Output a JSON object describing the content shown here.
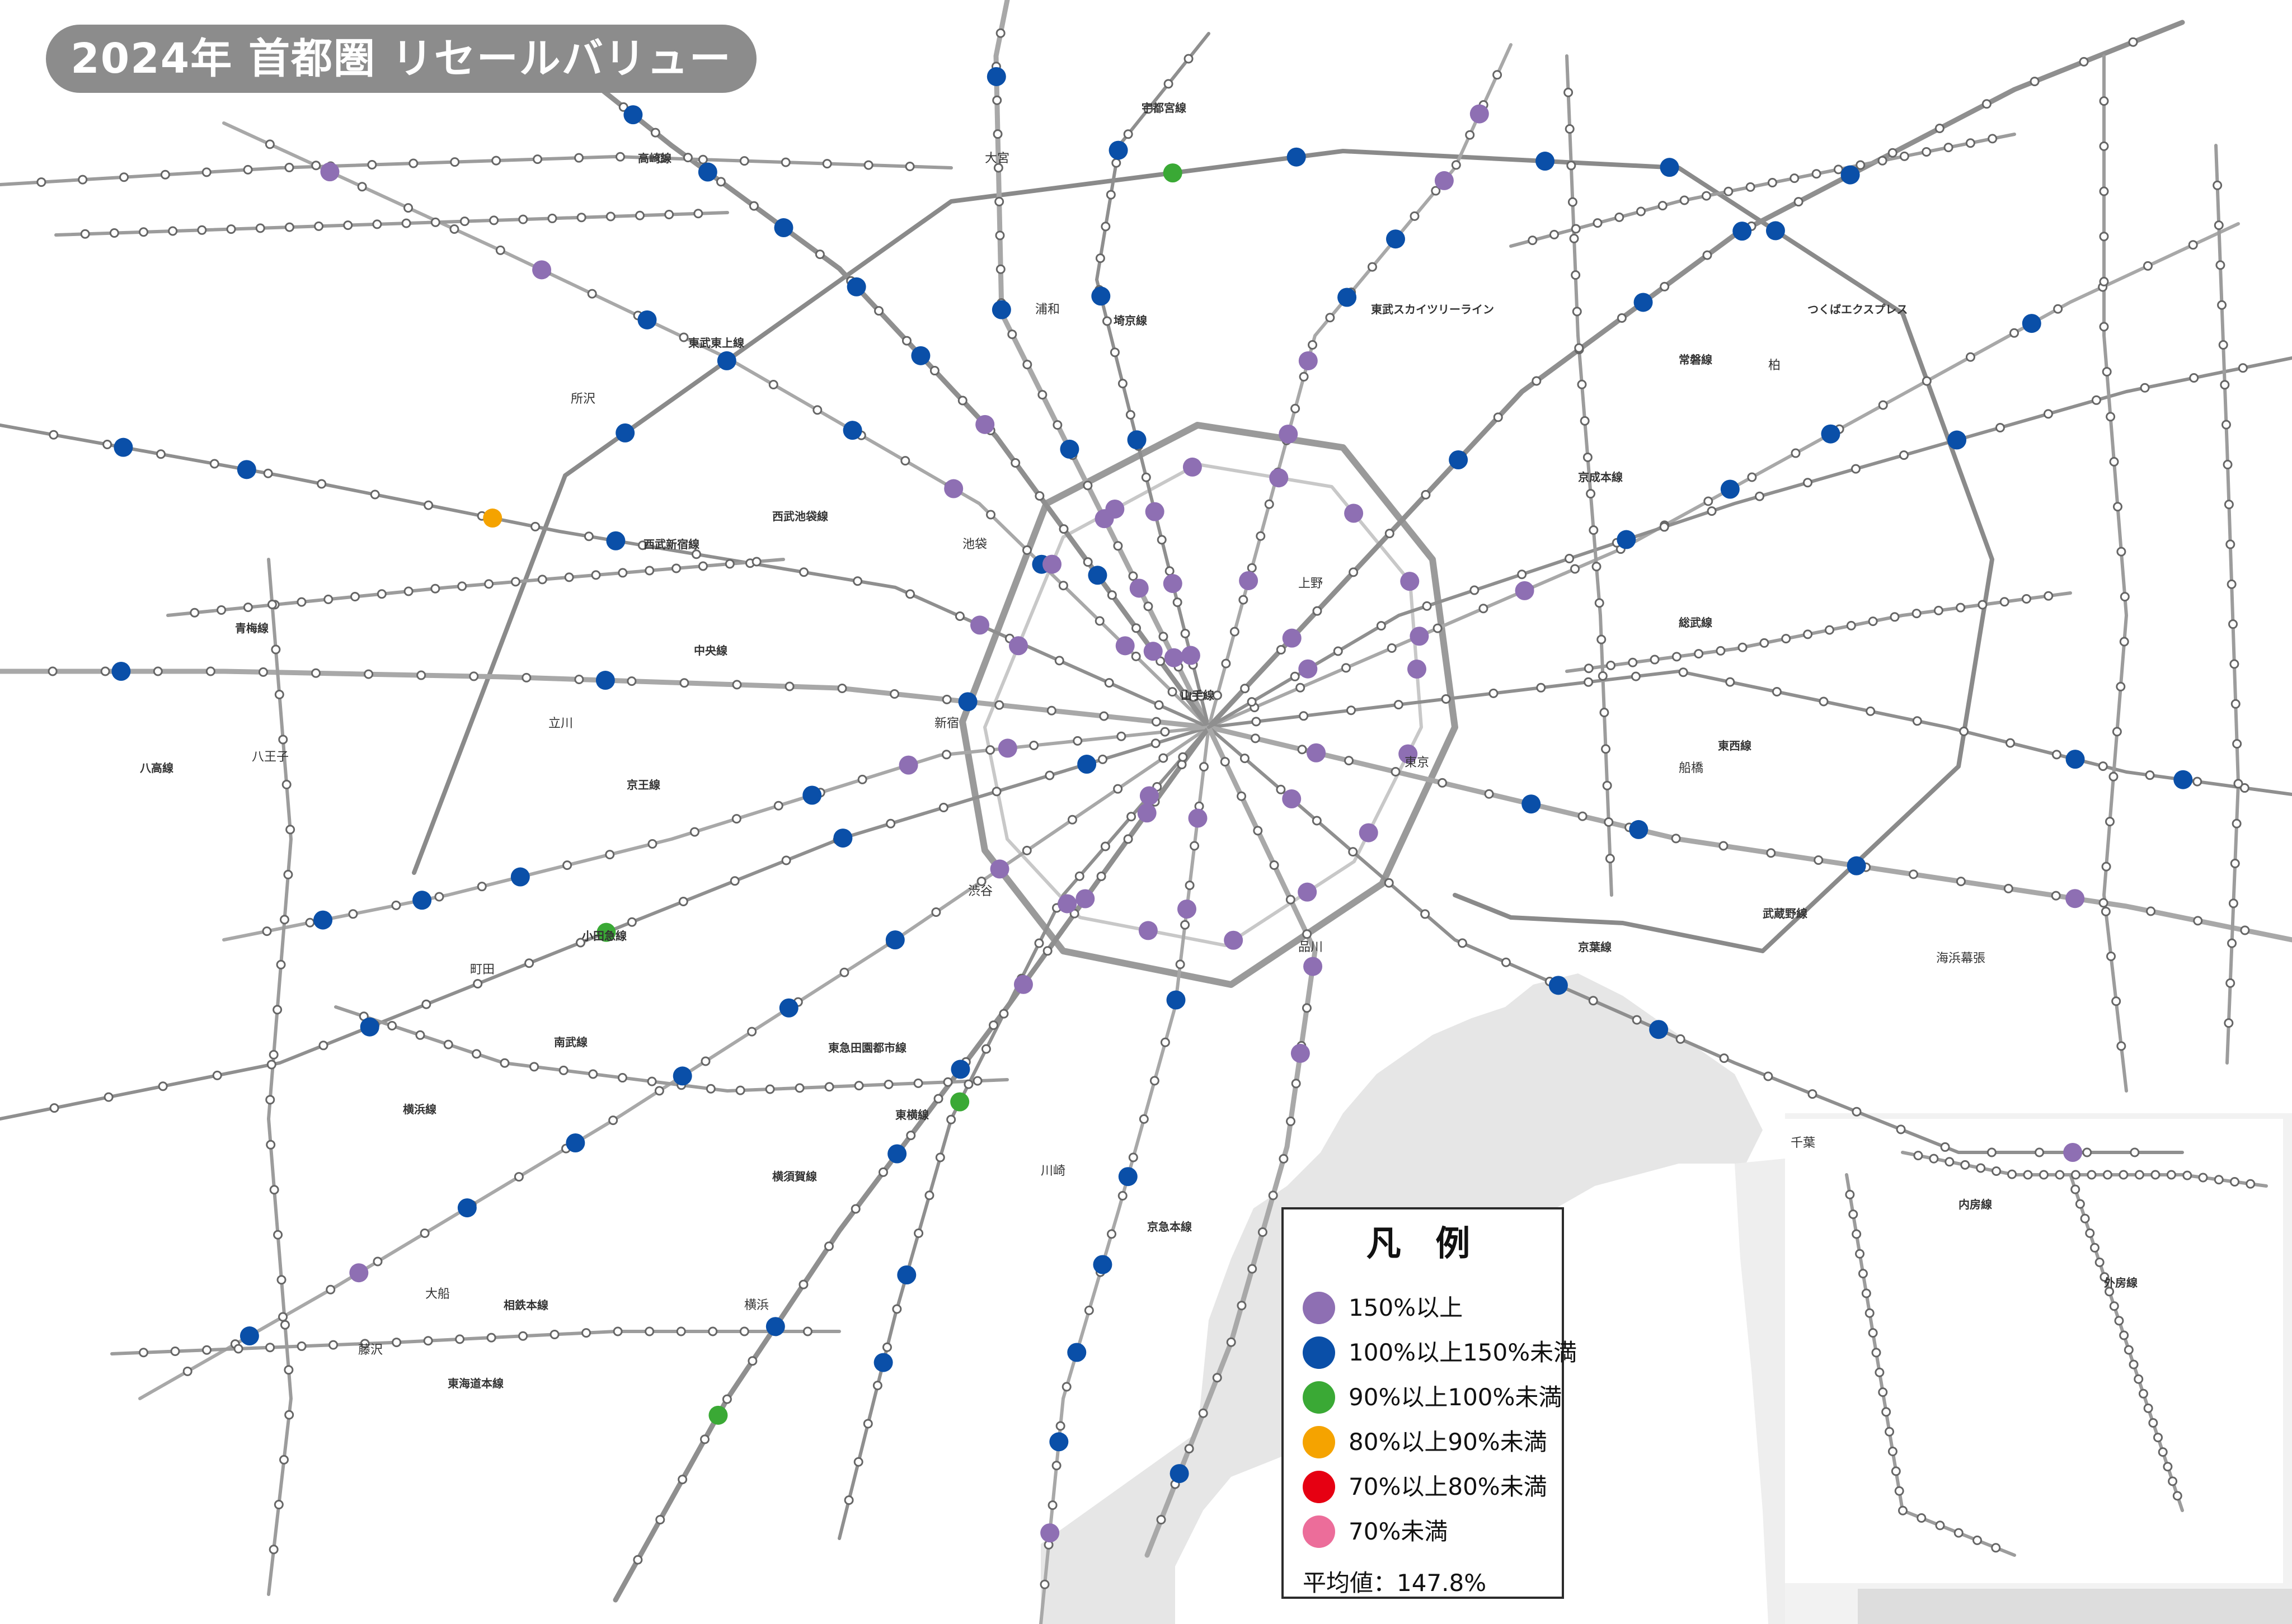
{
  "title": "2024年 首都圏 リセールバリュー",
  "legend": {
    "title": "凡 例",
    "items": [
      {
        "label": "150%以上",
        "color": "#8e6fb3"
      },
      {
        "label": "100%以上150%未満",
        "color": "#0a4fa8"
      },
      {
        "label": "90%以上100%未満",
        "color": "#3aa935"
      },
      {
        "label": "80%以上90%未満",
        "color": "#f5a300"
      },
      {
        "label": "70%以上80%未満",
        "color": "#e60012"
      },
      {
        "label": "70%未満",
        "color": "#ec6d9a"
      }
    ],
    "average": "平均値：147.8%"
  },
  "line_labels": [
    {
      "name": "東武東上線"
    },
    {
      "name": "西武池袋線"
    },
    {
      "name": "西武新宿線"
    },
    {
      "name": "中央線"
    },
    {
      "name": "京王線"
    },
    {
      "name": "小田急線"
    },
    {
      "name": "東急田園都市線"
    },
    {
      "name": "東横線"
    },
    {
      "name": "東海道本線"
    },
    {
      "name": "京急本線"
    },
    {
      "name": "京葉線"
    },
    {
      "name": "総武線"
    },
    {
      "name": "常磐線"
    },
    {
      "name": "つくばエクスプレス"
    },
    {
      "name": "武蔵野線"
    },
    {
      "name": "南武線"
    },
    {
      "name": "横浜線"
    },
    {
      "name": "相鉄本線"
    },
    {
      "name": "京成本線"
    },
    {
      "name": "東西線"
    },
    {
      "name": "埼京線"
    },
    {
      "name": "高崎線"
    },
    {
      "name": "宇都宮線"
    },
    {
      "name": "山手線"
    },
    {
      "name": "内房線"
    },
    {
      "name": "外房線"
    },
    {
      "name": "横須賀線"
    },
    {
      "name": "青梅線"
    },
    {
      "name": "八高線"
    },
    {
      "name": "東武スカイツリーライン"
    }
  ],
  "place_labels": [
    {
      "name": "新宿"
    },
    {
      "name": "池袋"
    },
    {
      "name": "渋谷"
    },
    {
      "name": "東京"
    },
    {
      "name": "品川"
    },
    {
      "name": "上野"
    },
    {
      "name": "横浜"
    },
    {
      "name": "大宮"
    },
    {
      "name": "千葉"
    },
    {
      "name": "船橋"
    },
    {
      "name": "立川"
    },
    {
      "name": "八王子"
    },
    {
      "name": "町田"
    },
    {
      "name": "川崎"
    },
    {
      "name": "柏"
    },
    {
      "name": "所沢"
    },
    {
      "name": "浦和"
    },
    {
      "name": "藤沢"
    },
    {
      "name": "大船"
    },
    {
      "name": "海浜幕張"
    }
  ]
}
